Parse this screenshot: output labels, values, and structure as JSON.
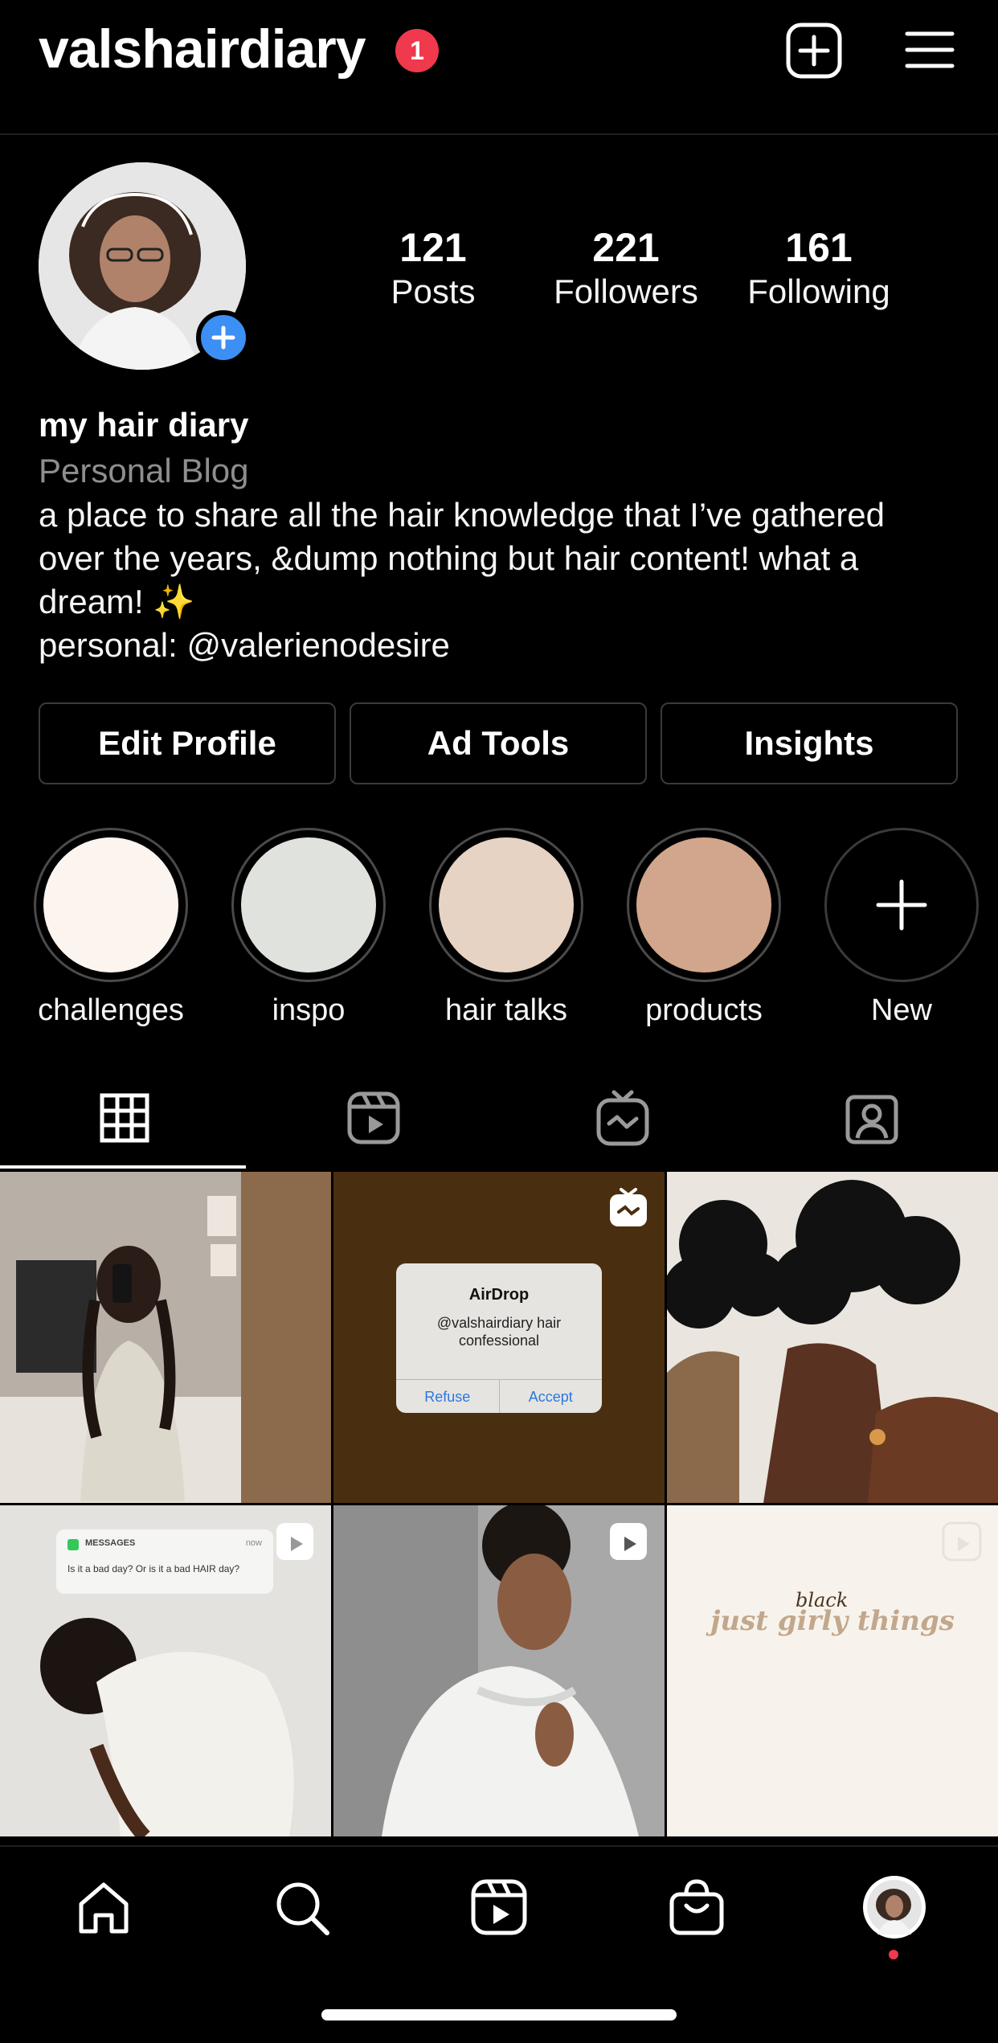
{
  "header": {
    "username": "valshairdiary",
    "notification_count": "1"
  },
  "stats": {
    "posts": {
      "count": "121",
      "label": "Posts"
    },
    "followers": {
      "count": "221",
      "label": "Followers"
    },
    "following": {
      "count": "161",
      "label": "Following"
    }
  },
  "bio": {
    "name": "my hair diary",
    "category": "Personal Blog",
    "line1": "a place to share all the hair knowledge that I’ve gathered",
    "line2": "over the years, &dump nothing but hair content! what a",
    "line3": "dream! ✨",
    "line4": "personal: @valerienodesire"
  },
  "actions": {
    "edit_profile": "Edit Profile",
    "ad_tools": "Ad Tools",
    "insights": "Insights"
  },
  "highlights": [
    {
      "label": "challenges",
      "color": "#fcf4ef"
    },
    {
      "label": "inspo",
      "color": "#dfe2dd"
    },
    {
      "label": "hair talks",
      "color": "#e6d3c4"
    },
    {
      "label": "products",
      "color": "#d2a68c"
    },
    {
      "label": "New"
    }
  ],
  "tabs": [
    {
      "icon": "grid-icon",
      "active": true
    },
    {
      "icon": "reels-icon"
    },
    {
      "icon": "igtv-icon"
    },
    {
      "icon": "tagged-icon"
    }
  ],
  "posts": {
    "airdrop": {
      "title": "AirDrop",
      "body": "@valshairdiary hair confessional",
      "refuse": "Refuse",
      "accept": "Accept"
    },
    "messages": {
      "app": "MESSAGES",
      "time": "now",
      "text": "Is it a bad day? Or is it a bad HAIR day?"
    },
    "girly": {
      "script": "black",
      "text": "just girly things"
    }
  },
  "bottom_nav": [
    "home-icon",
    "search-icon",
    "reels-icon",
    "shop-icon",
    "profile-avatar"
  ],
  "colors": {
    "accent_blue": "#3c8ff5",
    "badge_red": "#f0394c",
    "airdrop_bg": "#4a2e10"
  }
}
